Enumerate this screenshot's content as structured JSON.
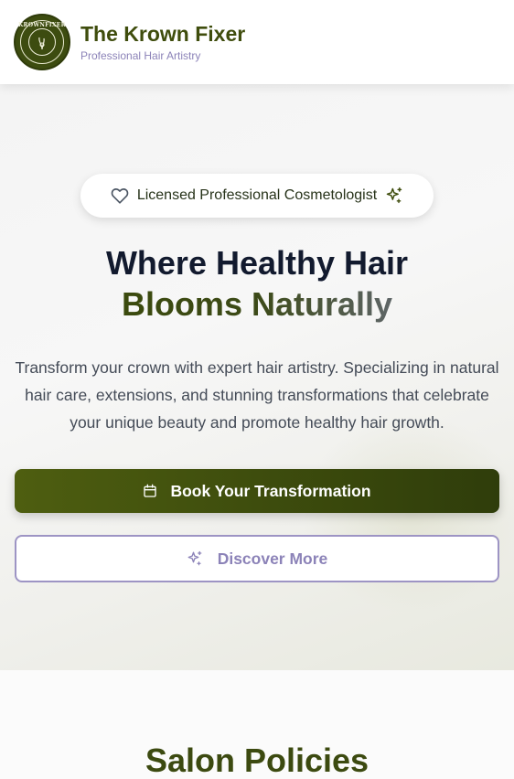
{
  "header": {
    "logo_text": "KROWNFIXER",
    "brand_name": "The Krown Fixer",
    "brand_subtitle": "Professional Hair Artistry"
  },
  "hero": {
    "badge_text": "Licensed Professional Cosmetologist",
    "title_line1": "Where Healthy Hair",
    "title_line2": "Blooms Naturally",
    "description": "Transform your crown with expert hair artistry. Specializing in natural hair care, extensions, and stunning transformations that celebrate your unique beauty and promote healthy hair growth.",
    "primary_button_label": "Book Your Transformation",
    "secondary_button_label": "Discover More"
  },
  "policies": {
    "title": "Salon Policies"
  },
  "colors": {
    "brand_green": "#3f4d0d",
    "accent_lavender": "#8c83b8",
    "title_dark": "#121a2e"
  },
  "icons": {
    "badge_left": "heart-icon",
    "badge_right": "sparkles-icon",
    "primary_button": "calendar-icon",
    "secondary_button": "sparkles-icon"
  }
}
